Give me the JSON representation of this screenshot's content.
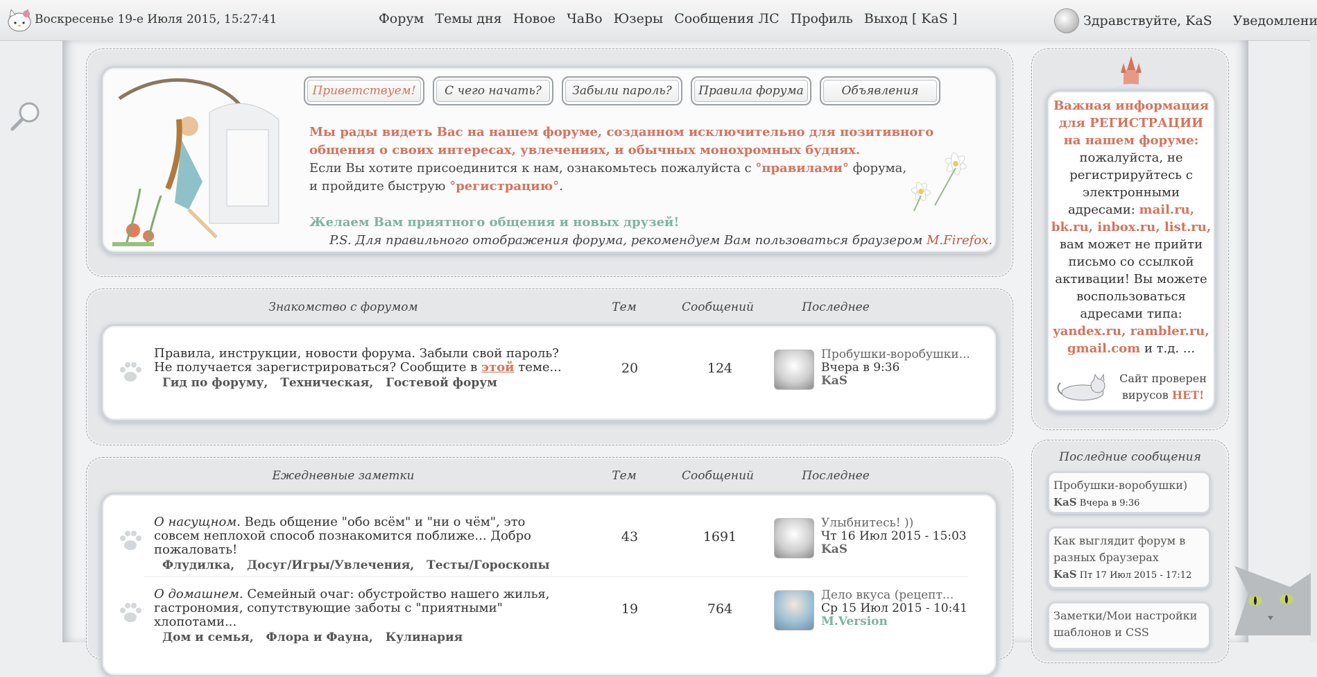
{
  "topbar": {
    "datetime": "Воскресенье 19-е Июля 2015, 15:27:41",
    "nav": [
      "Форум",
      "Темы дня",
      "Новое",
      "ЧаВо",
      "Юзеры",
      "Сообщения ЛС",
      "Профиль",
      "Выход [ KaS ]"
    ],
    "greeting": "Здравствуйте, KaS",
    "notifications": "Уведомления"
  },
  "welcome": {
    "tabs": [
      "Приветствуем!",
      "С чего начать?",
      "Забыли пароль?",
      "Правила форума",
      "Объявления"
    ],
    "line1": "Мы рады видеть Вас на нашем форуме, созданном исключительно для позитивного общения о своих интересах, увлечениях, и обычных монохромных буднях.",
    "line2a": "Если Вы хотите присоединится к нам, ознакомьтесь пожалуйста с ",
    "line2_link": "°правилами°",
    "line2b": " форума,",
    "line3a": "и пройдите быструю ",
    "line3_link": "°регистрацию°",
    "line3b": ".",
    "wish": "Желаем Вам приятного общения и новых друзей!",
    "ps": "P.S. Для правильного отображения форума, рекомендуем Вам пользоваться браузером ",
    "ps_link": "M.Firefox."
  },
  "sections": [
    {
      "title": "Знакомство с форумом",
      "col_topics": "Тем",
      "col_posts": "Сообщений",
      "col_last": "Последнее",
      "rows": [
        {
          "lead": "",
          "desc": "Правила, инструкции, новости форума. Забыли свой пароль? Не получается зарегистрироваться? Сообщите в ",
          "desc_link": "этой",
          "desc_tail": " теме...",
          "subforums": [
            "Гид по форуму",
            "Техническая",
            "Гостевой форум"
          ],
          "topics": "20",
          "posts": "124",
          "last_title": "Пробушки-воробушки...",
          "last_time": "Вчера в 9:36",
          "last_user": "KaS"
        }
      ]
    },
    {
      "title": "Ежедневные заметки",
      "col_topics": "Тем",
      "col_posts": "Сообщений",
      "col_last": "Последнее",
      "rows": [
        {
          "lead": "О насущном.",
          "desc": " Ведь общение \"обо всём\" и \"ни о чём\", это совсем неплохой способ познакомится поближе... Добро пожаловать!",
          "subforums": [
            "Флудилка",
            "Досуг/Игры/Увлечения",
            "Тесты/Гороскопы"
          ],
          "topics": "43",
          "posts": "1691",
          "last_title": "Улыбнитесь! ))",
          "last_time": "Чт 16 Июл 2015 - 15:03",
          "last_user": "KaS"
        },
        {
          "lead": "О домашнем.",
          "desc": " Семейный очаг: обустройство нашего жилья, гастрономия, сопутствующие заботы с \"приятными\" хлопотами...",
          "subforums": [
            "Дом и семья",
            "Флора и Фауна",
            "Кулинария"
          ],
          "topics": "19",
          "posts": "764",
          "last_title": "Дело вкуса (рецепт...",
          "last_time": "Ср 15 Июл 2015 - 10:41",
          "last_user": "M.Version"
        }
      ]
    }
  ],
  "sidebar": {
    "info_title": "Важная информация для РЕГИСТРАЦИИ на нашем форуме:",
    "info_text1": "пожалуйста, не регистрируйтесь с электронными адресами:",
    "info_bad": "mail.ru, bk.ru, inbox.ru, list.ru,",
    "info_text2": " вам может не прийти письмо со ссылкой активации! Вы можете воспользоваться адресами типа:",
    "info_good": "yandex.ru, rambler.ru, gmail.com",
    "info_text3": " и т.д. ...",
    "virus_text": "Сайт проверен вирусов ",
    "virus_no": "НЕТ!",
    "recent_title": "Последние сообщения",
    "recent": [
      {
        "title": "Пробушки-воробушки)",
        "user": "KaS",
        "time": "Вчера в 9:36"
      },
      {
        "title": "Как выглядит форум в разных браузерах",
        "user": "KaS",
        "time": "Пт 17 Июл 2015 - 17:12"
      },
      {
        "title": "Заметки/Мои настройки шаблонов и CSS",
        "user": "",
        "time": ""
      }
    ]
  },
  "colors": {
    "accent": "#d6735c",
    "green": "#7fb3a0",
    "text": "#333333"
  }
}
